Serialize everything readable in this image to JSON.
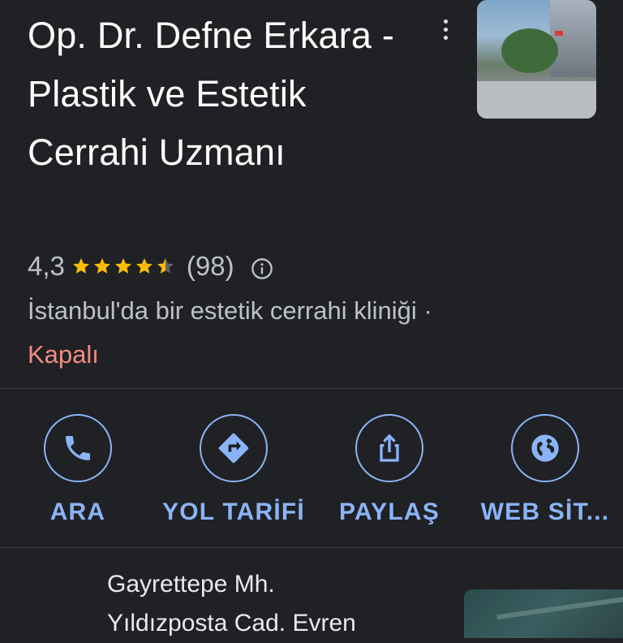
{
  "place": {
    "title": "Op. Dr. Defne Erkara - Plastik ve Estetik Cerrahi Uzmanı",
    "rating_value": "4,3",
    "rating_stars": 4.5,
    "rating_count": "(98)",
    "category": "İstanbul'da bir estetik cerrahi kliniği",
    "separator": " · ",
    "status": "Kapalı"
  },
  "icons": {
    "more": "more-vert-icon",
    "info": "info-icon",
    "star": "star-icon",
    "call": "phone-icon",
    "directions": "directions-icon",
    "share": "share-icon",
    "website": "globe-icon"
  },
  "colors": {
    "background": "#202124",
    "accent": "#8ab4f8",
    "star": "#fbbc04",
    "closed": "#f28b82",
    "secondary_text": "#bdc1c6"
  },
  "actions": [
    {
      "label": "ARA"
    },
    {
      "label": "YOL TARİFİ"
    },
    {
      "label": "PAYLAŞ"
    },
    {
      "label": "WEB SİT..."
    }
  ],
  "address": {
    "line1": "Gayrettepe Mh.",
    "line2": "Yıldızposta Cad. Evren"
  }
}
